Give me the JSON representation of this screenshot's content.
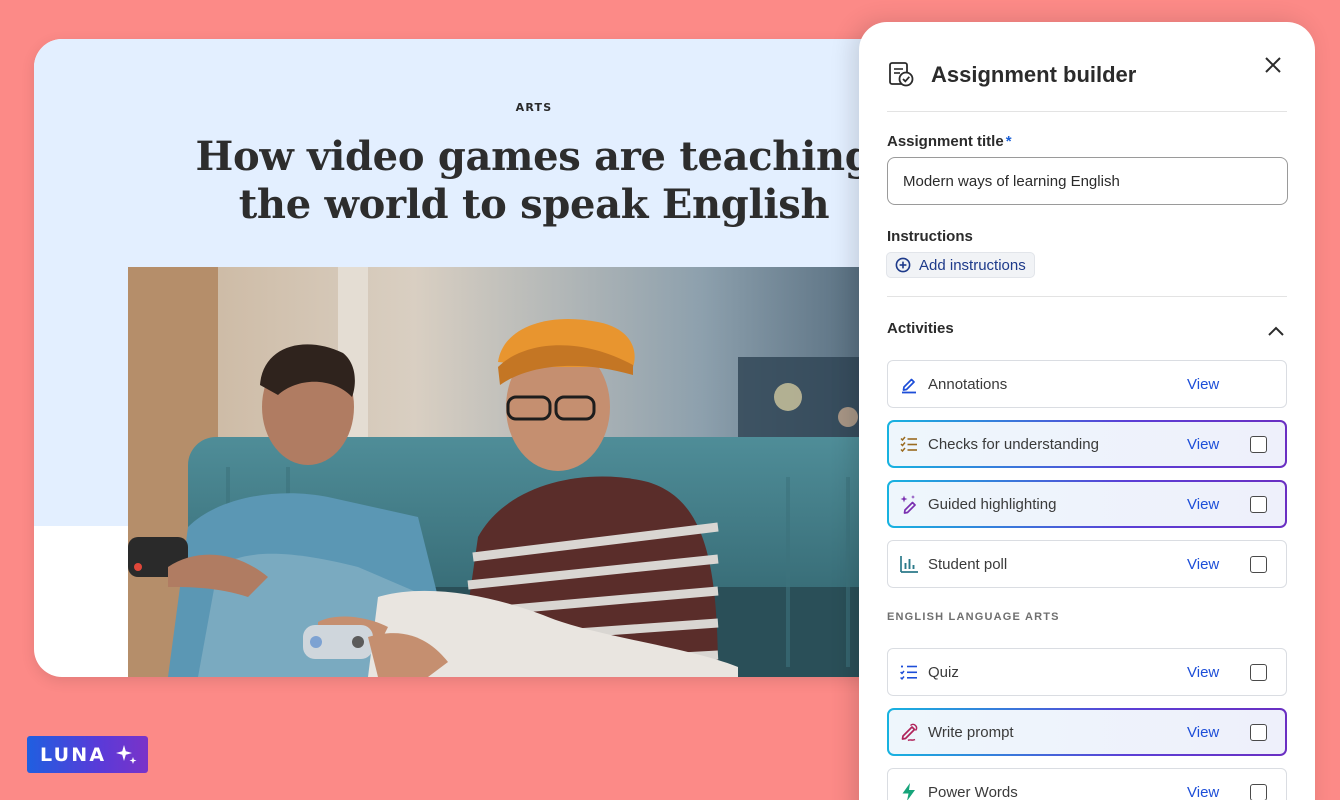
{
  "article": {
    "kicker": "ARTS",
    "title_line1": "How video games are teaching",
    "title_line2": "the world to speak English",
    "photo_icon": "photo-teens-playing-video-games"
  },
  "panel": {
    "title": "Assignment builder",
    "icon": "assignment-check-icon",
    "close_icon": "close-icon",
    "assignment_title_label": "Assignment title",
    "required_marker": "*",
    "assignment_title_value": "Modern ways of learning English",
    "instructions_label": "Instructions",
    "add_instructions_label": "Add instructions",
    "activities_label": "Activities",
    "activities": [
      {
        "label": "Annotations",
        "view": "View",
        "icon": "pen-highlight-icon",
        "highlighted": false,
        "checkbox": false
      },
      {
        "label": "Checks for understanding",
        "view": "View",
        "icon": "checklist-icon",
        "highlighted": true,
        "checkbox": true
      },
      {
        "label": "Guided highlighting",
        "view": "View",
        "icon": "sparkle-highlighter-icon",
        "highlighted": true,
        "checkbox": true
      },
      {
        "label": "Student poll",
        "view": "View",
        "icon": "bar-chart-icon",
        "highlighted": false,
        "checkbox": true
      }
    ],
    "ela_group_label": "ENGLISH LANGUAGE ARTS",
    "ela_activities": [
      {
        "label": "Quiz",
        "view": "View",
        "icon": "quiz-list-icon",
        "highlighted": false,
        "checkbox": true
      },
      {
        "label": "Write prompt",
        "view": "View",
        "icon": "pen-write-icon",
        "highlighted": true,
        "checkbox": true
      },
      {
        "label": "Power Words",
        "view": "View",
        "icon": "lightning-icon",
        "highlighted": false,
        "checkbox": true
      }
    ]
  },
  "brand": {
    "logo_text": "LUNA",
    "logo_icon": "sparkle-icon"
  },
  "colors": {
    "background": "#fc8a87",
    "article_header": "#e3efff",
    "link_blue": "#1d4ed8",
    "gradient_start": "#17b3e0",
    "gradient_end": "#6a2fc2"
  }
}
